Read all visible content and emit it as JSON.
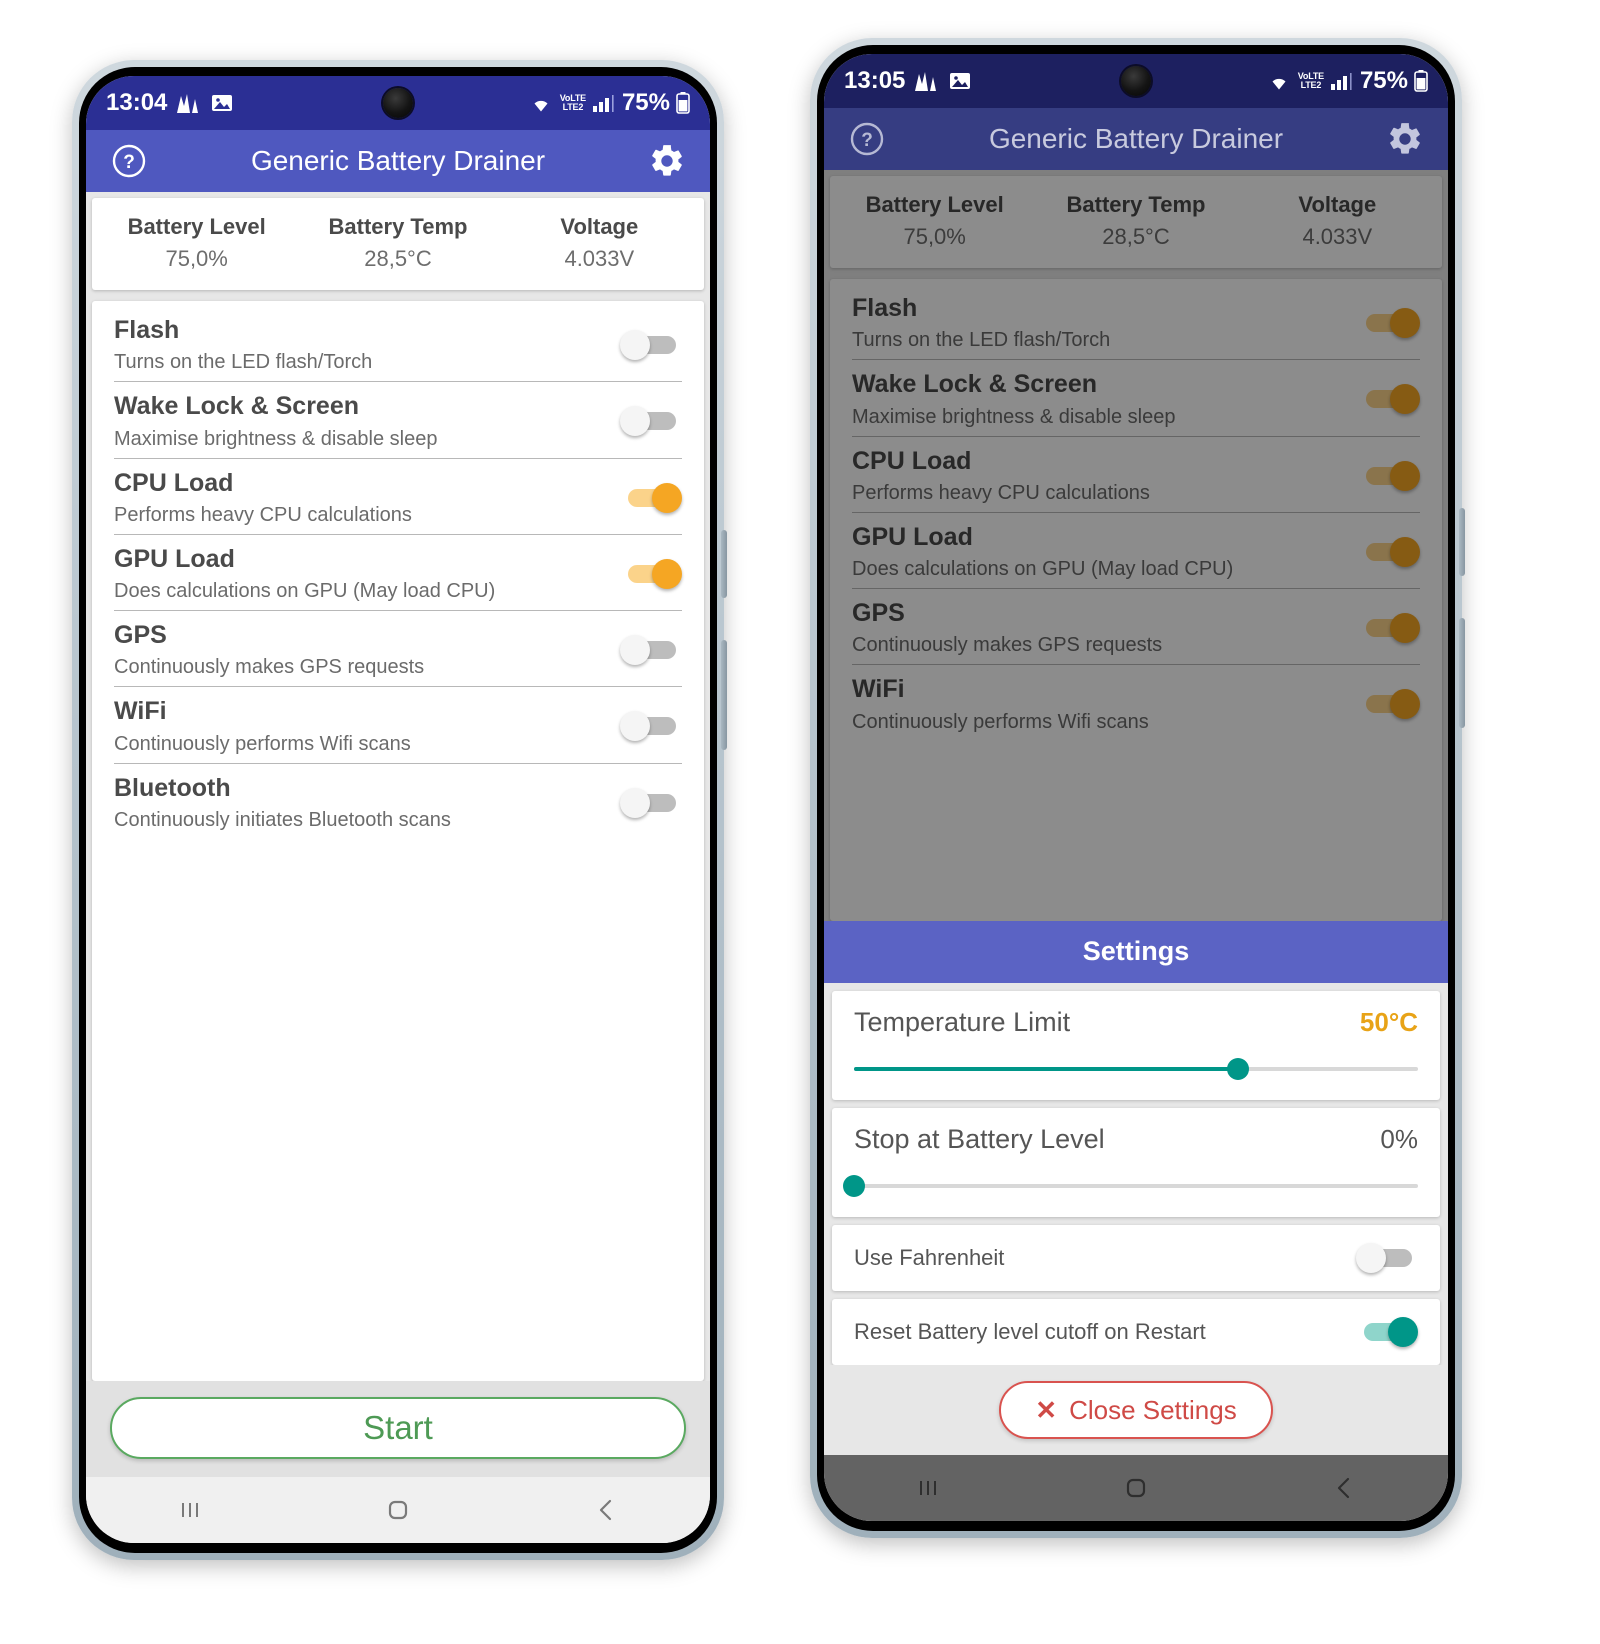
{
  "app": {
    "title": "Generic Battery Drainer",
    "help_icon": "help-circle-icon",
    "settings_icon": "gear-icon"
  },
  "colors": {
    "statusbar": "#2b2f94",
    "appbar": "#4f58bf",
    "settings_header": "#5b63c4",
    "toggle_on": "#f5a623",
    "slider_teal": "#009688",
    "value_amber": "#e8a317",
    "start_green": "#5aa960",
    "close_red": "#d9534f"
  },
  "left_phone": {
    "status_bar": {
      "time": "13:04",
      "network_label": "LTE2",
      "volte_label": "VoLTE",
      "battery_percent": "75%",
      "icons": [
        "signal-chart-icon",
        "image-icon",
        "wifi-icon",
        "cellular-bars-icon",
        "battery-icon"
      ]
    },
    "stats": [
      {
        "label": "Battery Level",
        "value": "75,0%"
      },
      {
        "label": "Battery Temp",
        "value": "28,5°C"
      },
      {
        "label": "Voltage",
        "value": "4.033V"
      }
    ],
    "drainers": [
      {
        "title": "Flash",
        "subtitle": "Turns on the LED flash/Torch",
        "on": false
      },
      {
        "title": "Wake Lock & Screen",
        "subtitle": "Maximise brightness & disable sleep",
        "on": false
      },
      {
        "title": "CPU Load",
        "subtitle": "Performs heavy CPU calculations",
        "on": true
      },
      {
        "title": "GPU Load",
        "subtitle": "Does calculations on GPU (May load CPU)",
        "on": true
      },
      {
        "title": "GPS",
        "subtitle": "Continuously makes GPS requests",
        "on": false
      },
      {
        "title": "WiFi",
        "subtitle": "Continuously performs Wifi scans",
        "on": false
      },
      {
        "title": "Bluetooth",
        "subtitle": "Continuously initiates Bluetooth scans",
        "on": false
      }
    ],
    "start_button": "Start"
  },
  "right_phone": {
    "status_bar": {
      "time": "13:05",
      "network_label": "LTE2",
      "volte_label": "VoLTE",
      "battery_percent": "75%"
    },
    "stats": [
      {
        "label": "Battery Level",
        "value": "75,0%"
      },
      {
        "label": "Battery Temp",
        "value": "28,5°C"
      },
      {
        "label": "Voltage",
        "value": "4.033V"
      }
    ],
    "drainers": [
      {
        "title": "Flash",
        "subtitle": "Turns on the LED flash/Torch",
        "on": true
      },
      {
        "title": "Wake Lock & Screen",
        "subtitle": "Maximise brightness & disable sleep",
        "on": true
      },
      {
        "title": "CPU Load",
        "subtitle": "Performs heavy CPU calculations",
        "on": true
      },
      {
        "title": "GPU Load",
        "subtitle": "Does calculations on GPU (May load CPU)",
        "on": true
      },
      {
        "title": "GPS",
        "subtitle": "Continuously makes GPS requests",
        "on": true
      },
      {
        "title": "WiFi",
        "subtitle": "Continuously performs Wifi scans",
        "on": true
      }
    ],
    "settings": {
      "header": "Settings",
      "temperature_limit": {
        "label": "Temperature Limit",
        "value": "50°C",
        "slider_percent": 68
      },
      "stop_at_battery_level": {
        "label": "Stop at Battery Level",
        "value": "0%",
        "slider_percent": 0
      },
      "use_fahrenheit": {
        "label": "Use Fahrenheit",
        "on": false
      },
      "reset_cutoff": {
        "label": "Reset Battery level cutoff on Restart",
        "on": true
      },
      "close_button": "Close Settings",
      "close_icon": "close-x-icon"
    }
  },
  "nav_bar": {
    "recents_icon": "recents-icon",
    "home_icon": "home-icon",
    "back_icon": "back-chevron-icon"
  }
}
